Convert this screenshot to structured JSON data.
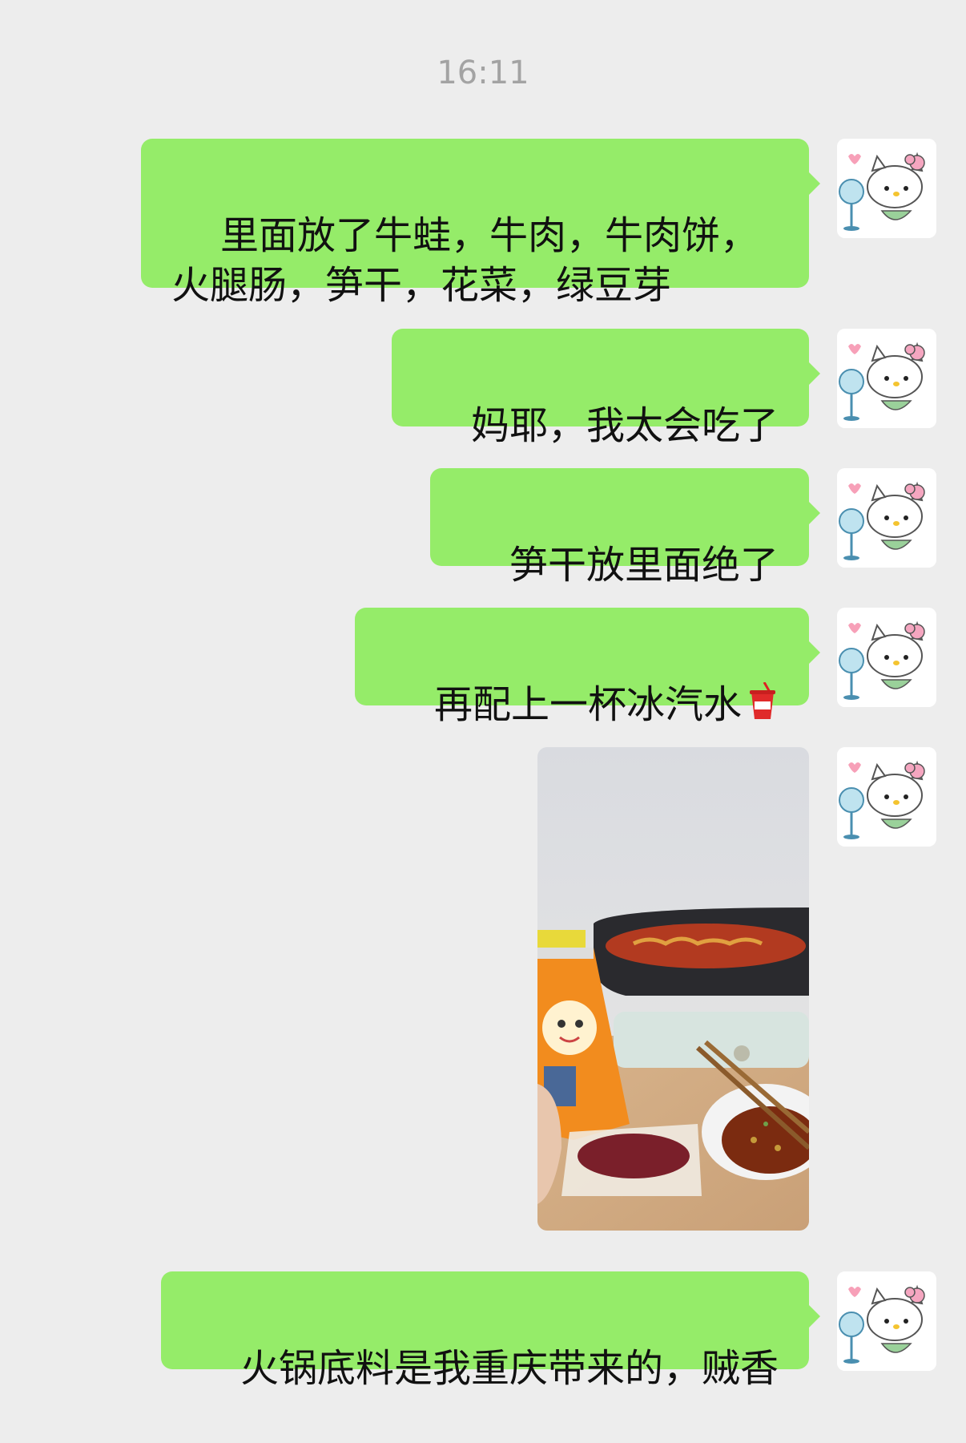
{
  "chat": {
    "timestamp": "16:11",
    "messages": [
      {
        "type": "text",
        "text": "里面放了牛蛙，牛肉，牛肉饼，火腿肠，笋干，花菜，绿豆芽"
      },
      {
        "type": "text",
        "text": "妈耶，我太会吃了"
      },
      {
        "type": "text",
        "text": "笋干放里面绝了"
      },
      {
        "type": "text",
        "text": "再配上一杯冰汽水",
        "emoji": "cup-with-straw"
      },
      {
        "type": "image",
        "icon": "hotpot-photo"
      },
      {
        "type": "text",
        "text": "火锅底料是我重庆带来的，贼香"
      }
    ]
  },
  "avatar": {
    "icon": "hello-kitty-avatar"
  },
  "colors": {
    "background": "#ededed",
    "bubble_sent": "#95ec69",
    "timestamp_text": "#a3a3a3"
  }
}
